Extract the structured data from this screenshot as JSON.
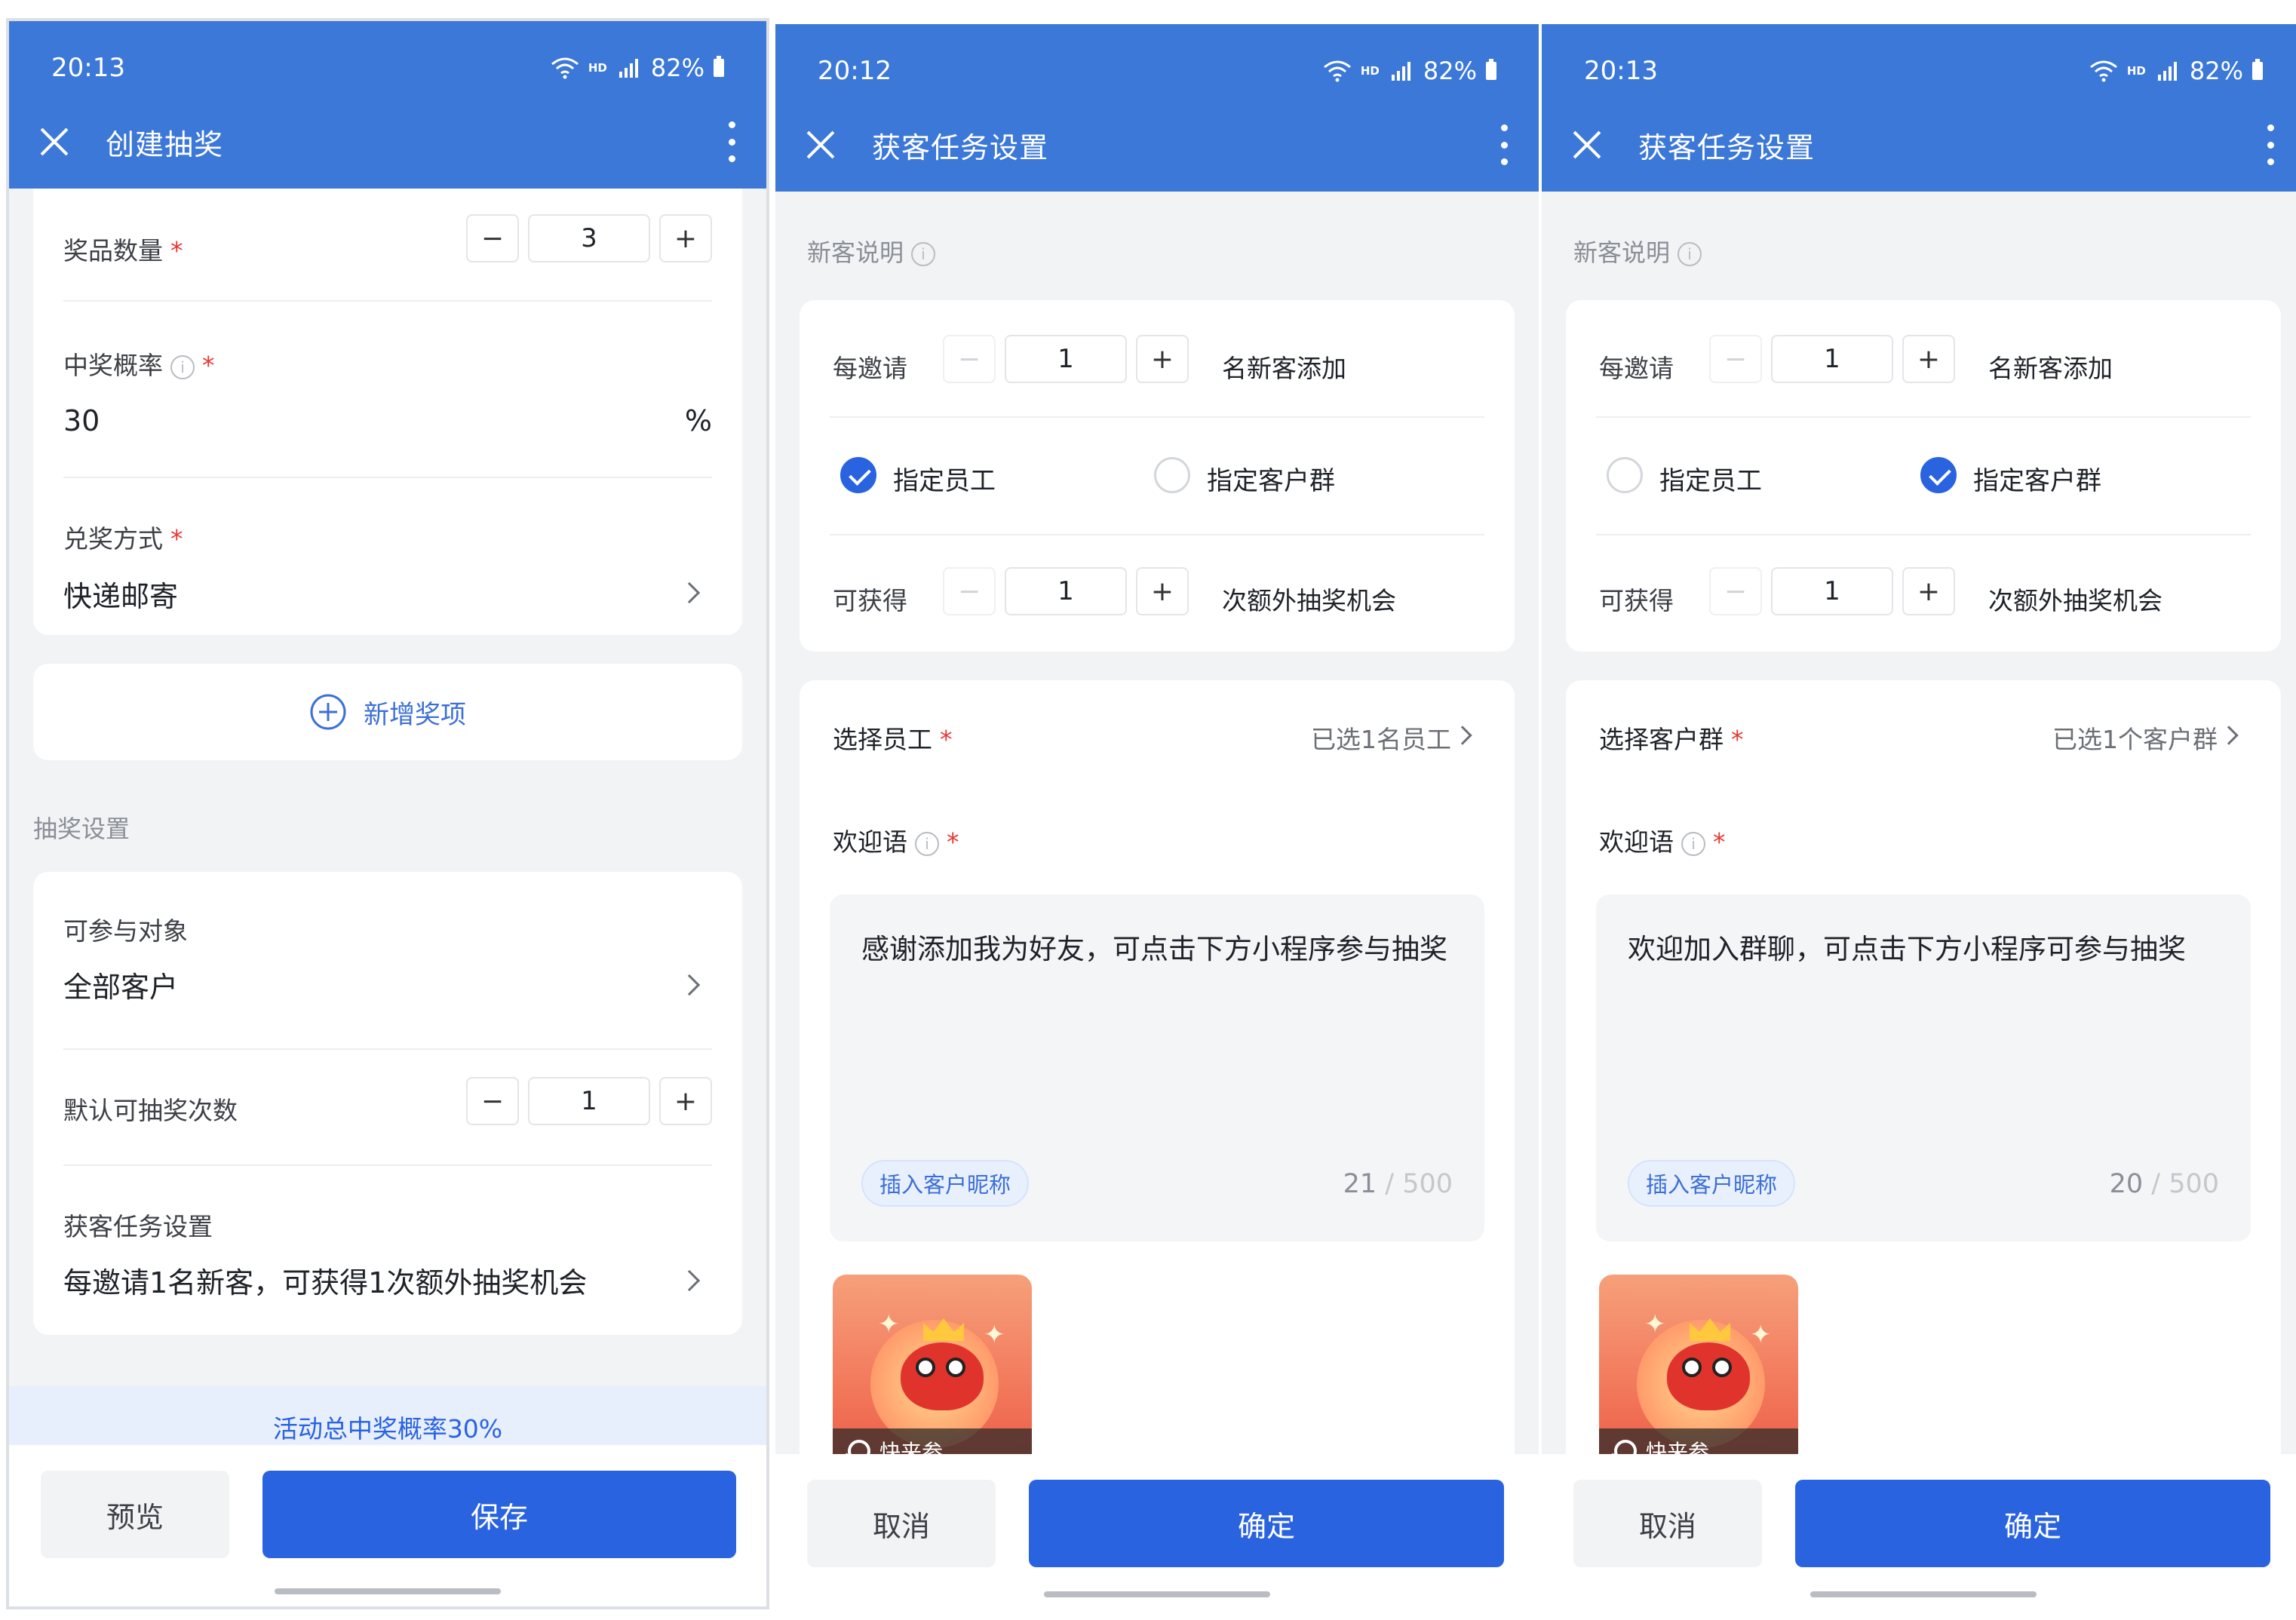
{
  "screens": [
    {
      "status": {
        "time": "20:13",
        "hd": "HD",
        "network": "4G",
        "battery": "82%"
      },
      "title": "创建抽奖",
      "prize_count": {
        "label": "奖品数量",
        "value": "3",
        "minus": "−",
        "plus": "+"
      },
      "win_rate": {
        "label": "中奖概率",
        "info": "i",
        "value": "30",
        "unit": "%"
      },
      "redeem": {
        "label": "兑奖方式",
        "value": "快递邮寄"
      },
      "add_prize": "新增奖项",
      "lottery_section": "抽奖设置",
      "participants": {
        "label": "可参与对象",
        "value": "全部客户"
      },
      "default_times": {
        "label": "默认可抽奖次数",
        "value": "1",
        "minus": "−",
        "plus": "+"
      },
      "acquisition": {
        "label": "获客任务设置",
        "value": "每邀请1名新客，可获得1次额外抽奖机会"
      },
      "notice": "活动总中奖概率30%",
      "preview": "预览",
      "save": "保存"
    },
    {
      "status": {
        "time": "20:12",
        "hd": "HD",
        "network": "4G",
        "battery": "82%"
      },
      "title": "获客任务设置",
      "section": "新客说明",
      "invite": {
        "prefix": "每邀请",
        "value": "1",
        "suffix": "名新客添加",
        "minus": "−",
        "plus": "+"
      },
      "option_staff": "指定员工",
      "option_group": "指定客户群",
      "selected_option": "staff",
      "gain": {
        "prefix": "可获得",
        "value": "1",
        "suffix": "次额外抽奖机会",
        "minus": "−",
        "plus": "+"
      },
      "select": {
        "label": "选择员工",
        "value": "已选1名员工"
      },
      "welcome": {
        "label": "欢迎语",
        "text": "感谢添加我为好友，可点击下方小程序参与抽奖",
        "tag": "插入客户昵称",
        "count": "21",
        "max": "500"
      },
      "mini_program": "快来参...",
      "cancel": "取消",
      "confirm": "确定"
    },
    {
      "status": {
        "time": "20:13",
        "hd": "HD",
        "network": "4G",
        "battery": "82%"
      },
      "title": "获客任务设置",
      "section": "新客说明",
      "invite": {
        "prefix": "每邀请",
        "value": "1",
        "suffix": "名新客添加",
        "minus": "−",
        "plus": "+"
      },
      "option_staff": "指定员工",
      "option_group": "指定客户群",
      "selected_option": "group",
      "gain": {
        "prefix": "可获得",
        "value": "1",
        "suffix": "次额外抽奖机会",
        "minus": "−",
        "plus": "+"
      },
      "select": {
        "label": "选择客户群",
        "value": "已选1个客户群"
      },
      "welcome": {
        "label": "欢迎语",
        "text": "欢迎加入群聊，可点击下方小程序可参与抽奖",
        "tag": "插入客户昵称",
        "count": "20",
        "max": "500"
      },
      "mini_program": "快来参...",
      "cancel": "取消",
      "confirm": "确定"
    }
  ],
  "colors": {
    "header": "#3c78d8",
    "primary": "#2a63e0",
    "required": "#e53935",
    "background": "#f2f3f5"
  }
}
